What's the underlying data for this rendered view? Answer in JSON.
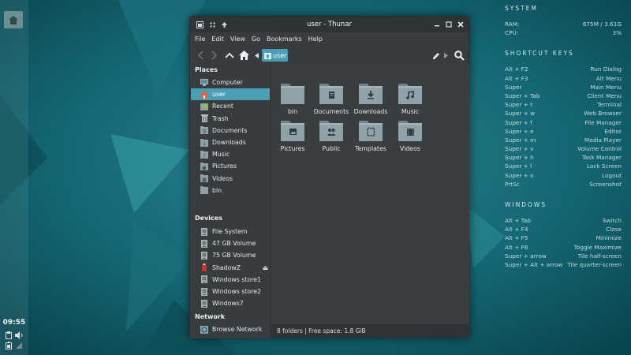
{
  "panel": {
    "clock": "09:55"
  },
  "window": {
    "title": "user - Thunar",
    "menu": [
      "File",
      "Edit",
      "View",
      "Go",
      "Bookmarks",
      "Help"
    ],
    "path_label": "user",
    "status": "8 folders  |  Free space: 1.8 GiB"
  },
  "sidebar": {
    "places_title": "Places",
    "places": [
      {
        "label": "Computer",
        "icon": "computer-icon"
      },
      {
        "label": "user",
        "icon": "home-icon"
      },
      {
        "label": "Recent",
        "icon": "recent-icon"
      },
      {
        "label": "Trash",
        "icon": "trash-icon"
      },
      {
        "label": "Documents",
        "icon": "documents-icon"
      },
      {
        "label": "Downloads",
        "icon": "downloads-icon"
      },
      {
        "label": "Music",
        "icon": "music-icon"
      },
      {
        "label": "Pictures",
        "icon": "pictures-icon"
      },
      {
        "label": "Videos",
        "icon": "videos-icon"
      },
      {
        "label": "bin",
        "icon": "folder-icon"
      }
    ],
    "devices_title": "Devices",
    "devices": [
      {
        "label": "File System",
        "icon": "drive-icon"
      },
      {
        "label": "47 GB Volume",
        "icon": "drive-icon"
      },
      {
        "label": "75 GB Volume",
        "icon": "drive-icon"
      },
      {
        "label": "ShadowZ",
        "icon": "usb-drive-icon"
      },
      {
        "label": "Windows store1",
        "icon": "drive-icon"
      },
      {
        "label": "Windows store2",
        "icon": "drive-icon"
      },
      {
        "label": "Windows7",
        "icon": "drive-icon"
      }
    ],
    "network_title": "Network",
    "network": [
      {
        "label": "Browse Network",
        "icon": "network-icon"
      }
    ]
  },
  "folders": [
    {
      "label": "bin",
      "emblem": ""
    },
    {
      "label": "Documents",
      "emblem": "document"
    },
    {
      "label": "Downloads",
      "emblem": "download"
    },
    {
      "label": "Music",
      "emblem": "music"
    },
    {
      "label": "Pictures",
      "emblem": "picture"
    },
    {
      "label": "Public",
      "emblem": "people"
    },
    {
      "label": "Templates",
      "emblem": "template"
    },
    {
      "label": "Videos",
      "emblem": "video"
    }
  ],
  "conky": {
    "system_title": "SYSTEM",
    "system": [
      {
        "key": "RAM:",
        "value": "875M / 3.61G"
      },
      {
        "key": "CPU:",
        "value": "3%"
      }
    ],
    "shortcuts_title": "SHORTCUT KEYS",
    "shortcuts": [
      {
        "key": "Alt + F2",
        "value": "Run Dialog"
      },
      {
        "key": "Alt + F3",
        "value": "Alt Menu"
      },
      {
        "key": "Super",
        "value": "Main Menu"
      },
      {
        "key": "Super + Tab",
        "value": "Client Menu"
      },
      {
        "key": "Super + t",
        "value": "Terminal"
      },
      {
        "key": "Super + w",
        "value": "Web Browser"
      },
      {
        "key": "Super + f",
        "value": "File Manager"
      },
      {
        "key": "Super + e",
        "value": "Editor"
      },
      {
        "key": "Super + m",
        "value": "Media Player"
      },
      {
        "key": "Super + v",
        "value": "Volume Control"
      },
      {
        "key": "Super + h",
        "value": "Task Manager"
      },
      {
        "key": "Super + l",
        "value": "Lock Screen"
      },
      {
        "key": "Super + x",
        "value": "Logout"
      },
      {
        "key": "PrtSc",
        "value": "Screenshot"
      }
    ],
    "windows_title": "WINDOWS",
    "windows": [
      {
        "key": "Alt + Tab",
        "value": "Switch"
      },
      {
        "key": "Alt + F4",
        "value": "Close"
      },
      {
        "key": "Alt + F5",
        "value": "Minimize"
      },
      {
        "key": "Alt + F6",
        "value": "Toggle Maximize"
      },
      {
        "key": "Super + arrow",
        "value": "Tile half-screen"
      },
      {
        "key": "Super + Alt + arrow",
        "value": "Tile quarter-screen"
      }
    ]
  },
  "colors": {
    "accent": "#4a9fb5",
    "window_bg": "#383c3f",
    "folder": "#8fa2a8"
  }
}
